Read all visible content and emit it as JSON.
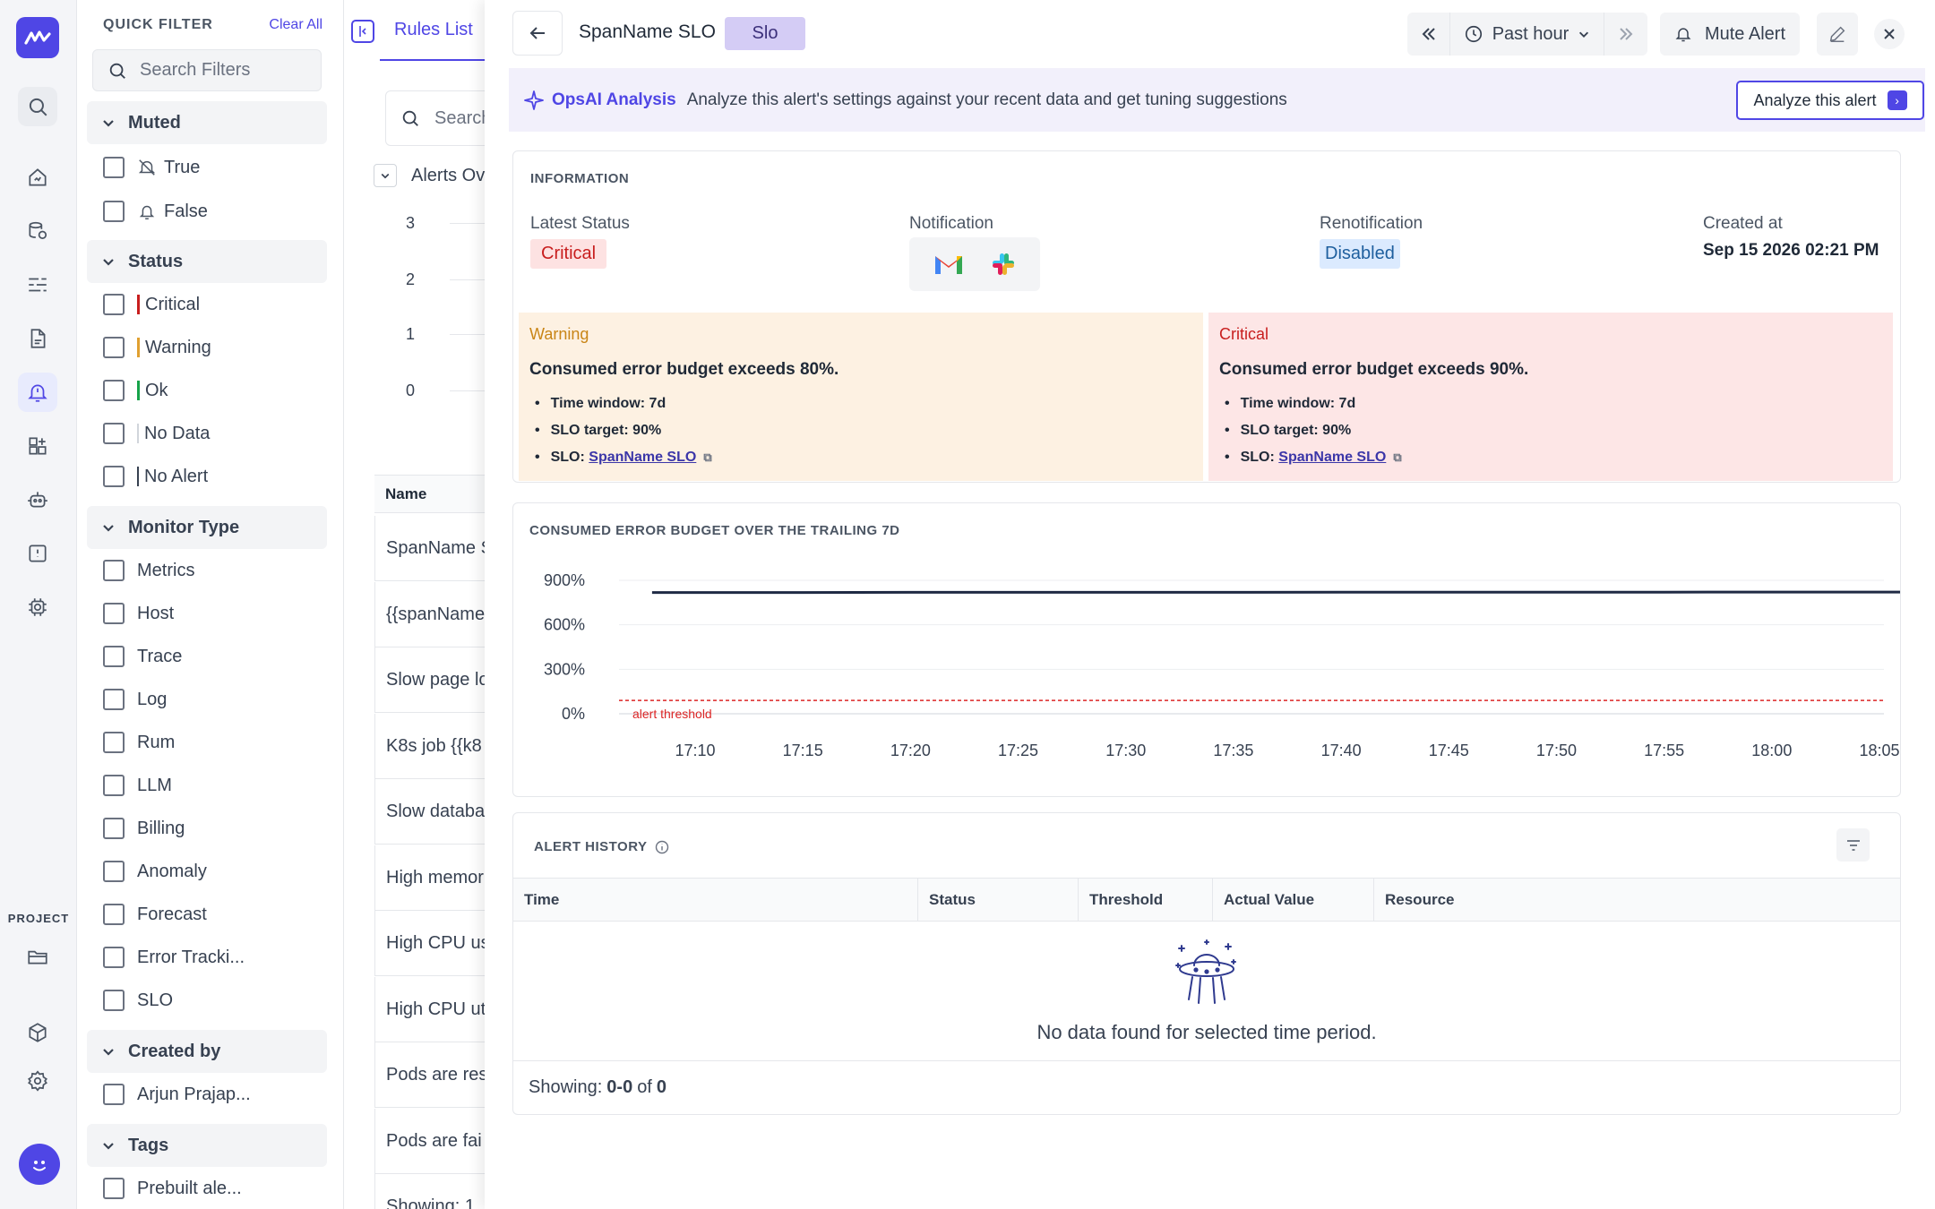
{
  "icons": {
    "logo": "logo-icon",
    "rail": [
      "search-icon",
      "home-icon",
      "database-icon",
      "traces-icon",
      "file-icon",
      "alerts-icon",
      "dashboard-icon",
      "bot-icon",
      "incident-icon",
      "cpu-icon"
    ],
    "project": [
      "folder-icon",
      "cube-icon",
      "gear-icon"
    ]
  },
  "rail": {
    "project_label": "PROJECT"
  },
  "quick_filter": {
    "title": "QUICK FILTER",
    "clear_all": "Clear All",
    "search_placeholder": "Search Filters",
    "sections": [
      {
        "name": "Muted",
        "options": [
          "True",
          "False"
        ]
      },
      {
        "name": "Status",
        "options": [
          "Critical",
          "Warning",
          "Ok",
          "No Data",
          "No Alert"
        ]
      },
      {
        "name": "Monitor Type",
        "options": [
          "Metrics",
          "Host",
          "Trace",
          "Log",
          "Rum",
          "LLM",
          "Billing",
          "Anomaly",
          "Forecast",
          "Error Tracki...",
          "SLO"
        ]
      },
      {
        "name": "Created by",
        "options": [
          "Arjun Prajap..."
        ]
      },
      {
        "name": "Tags",
        "options": [
          "Prebuilt ale..."
        ]
      }
    ]
  },
  "rules_list": {
    "tab": "Rules List",
    "search_placeholder": "Search",
    "overview": "Alerts Ov",
    "ticks": [
      "3",
      "2",
      "1",
      "0"
    ],
    "col_name": "Name",
    "rows": [
      "SpanName S",
      "{{spanName",
      "Slow page lo",
      "K8s job {{k8",
      "Slow databa",
      "High memor",
      "High CPU us",
      "High CPU ut",
      "Pods are res",
      "Pods are fai",
      "Showing: 1"
    ]
  },
  "drawer": {
    "title": "SpanName SLO",
    "badge": "Slo",
    "time_range": "Past hour",
    "mute": "Mute Alert",
    "opsai": {
      "label": "OpsAI Analysis",
      "desc": "Analyze this alert's settings against your recent data and get tuning suggestions",
      "button": "Analyze this alert"
    },
    "info": {
      "caption": "INFORMATION",
      "latest_status_label": "Latest Status",
      "latest_status": "Critical",
      "notification_label": "Notification",
      "renotification_label": "Renotification",
      "renotification": "Disabled",
      "created_label": "Created at",
      "created": "Sep 15 2026 02:21 PM"
    },
    "warning": {
      "name": "Warning",
      "condition": "Consumed error budget exceeds 80%.",
      "time_window": "Time window: 7d",
      "slo_target": "SLO target: 90%",
      "slo_label": "SLO: ",
      "slo_link": "SpanName SLO"
    },
    "critical": {
      "name": "Critical",
      "condition": "Consumed error budget exceeds 90%.",
      "time_window": "Time window: 7d",
      "slo_target": "SLO target: 90%",
      "slo_label": "SLO: ",
      "slo_link": "SpanName SLO"
    },
    "history": {
      "caption": "ALERT HISTORY",
      "columns": [
        "Time",
        "Status",
        "Threshold",
        "Actual Value",
        "Resource"
      ],
      "empty": "No data found for selected time period.",
      "showing_label": "Showing:",
      "showing_range": "0-0",
      "of": "of",
      "total": "0"
    }
  },
  "colors": {
    "accent": "#4f46e5",
    "critical": "#c81e1e",
    "warning": "#e0a030",
    "ok": "#16a34a",
    "series": "#1f2a44",
    "threshold": "#dc2626"
  },
  "chart_data": {
    "type": "line",
    "title": "CONSUMED ERROR BUDGET OVER THE TRAILING 7D",
    "ytick_labels": [
      "900%",
      "600%",
      "300%",
      "0%"
    ],
    "yticks": [
      900,
      600,
      300,
      0
    ],
    "ylim": [
      0,
      900
    ],
    "x": [
      "17:08",
      "17:10",
      "17:15",
      "17:20",
      "17:25",
      "17:30",
      "17:35",
      "17:40",
      "17:45",
      "17:50",
      "17:55",
      "18:00",
      "18:05",
      "18:06"
    ],
    "xtick_labels": [
      "17:10",
      "17:15",
      "17:20",
      "17:25",
      "17:30",
      "17:35",
      "17:40",
      "17:45",
      "17:50",
      "17:55",
      "18:00",
      "18:05"
    ],
    "series": [
      {
        "values": [
          818,
          818,
          818,
          819,
          819,
          819,
          819,
          820,
          820,
          820,
          820,
          821,
          821,
          821
        ]
      }
    ],
    "threshold": {
      "label": "alert threshold",
      "value": 90
    },
    "grid": true
  }
}
